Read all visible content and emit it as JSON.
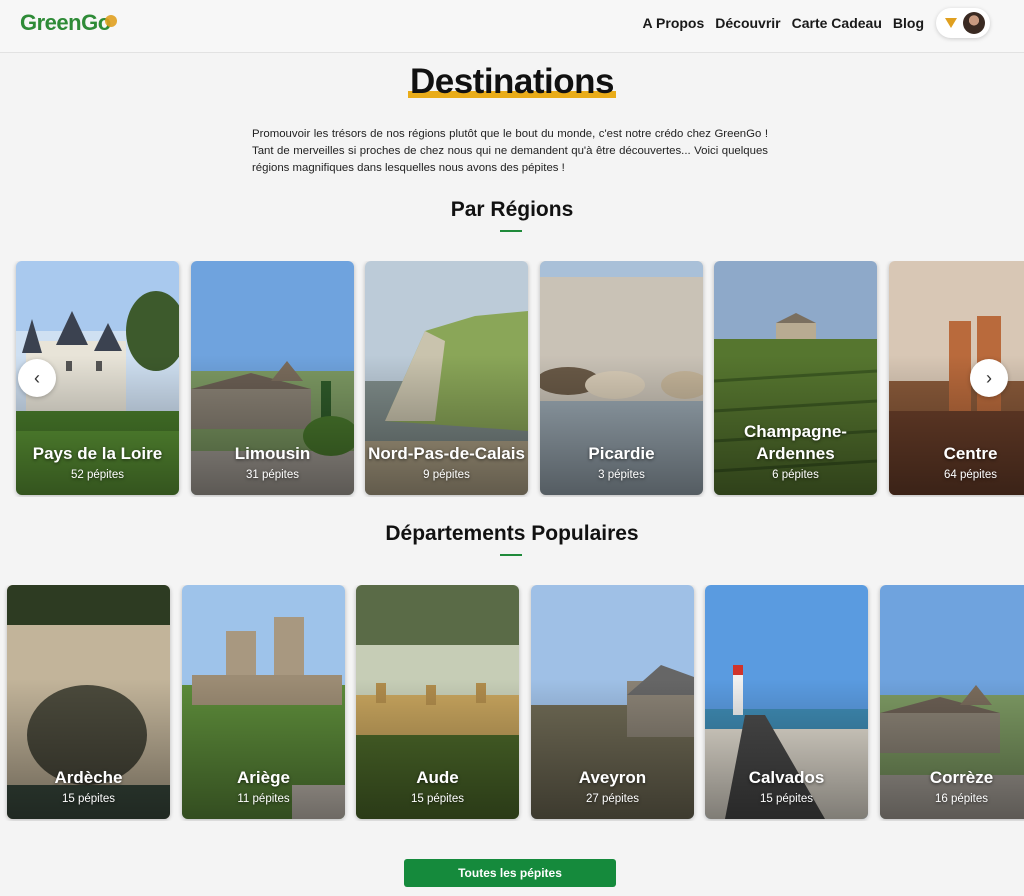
{
  "header": {
    "logo": "GreenGo",
    "nav": [
      "A Propos",
      "Découvrir",
      "Carte Cadeau",
      "Blog"
    ]
  },
  "title": "Destinations",
  "intro": "Promouvoir les trésors de nos régions plutôt que le bout du monde, c'est notre crédo chez GreenGo ! Tant de merveilles si proches de chez nous qui ne demandent qu'à être découvertes... Voici quelques régions magnifiques dans lesquelles nous avons des pépites !",
  "regions": {
    "title": "Par Régions",
    "items": [
      {
        "name": "Pays de la Loire",
        "count": "52 pépites"
      },
      {
        "name": "Limousin",
        "count": "31 pépites"
      },
      {
        "name": "Nord-Pas-de-Calais",
        "count": "9 pépites"
      },
      {
        "name": "Picardie",
        "count": "3 pépites"
      },
      {
        "name": "Champagne-Ardennes",
        "count": "6 pépites"
      },
      {
        "name": "Centre",
        "count": "64 pépites"
      }
    ]
  },
  "departments": {
    "title": "Départements Populaires",
    "items": [
      {
        "name": "Ardèche",
        "count": "15 pépites"
      },
      {
        "name": "Ariège",
        "count": "11 pépites"
      },
      {
        "name": "Aude",
        "count": "15 pépites"
      },
      {
        "name": "Aveyron",
        "count": "27 pépites"
      },
      {
        "name": "Calvados",
        "count": "15 pépites"
      },
      {
        "name": "Corrèze",
        "count": "16 pépites"
      }
    ]
  },
  "cta": "Toutes les pépites",
  "icons": {
    "prev": "chevron-left-icon",
    "next": "chevron-right-icon",
    "menu": "caret-down-icon"
  },
  "colors": {
    "brand_green": "#2e8b37",
    "accent_yellow": "#e9ac19",
    "button_green": "#158a3c"
  }
}
